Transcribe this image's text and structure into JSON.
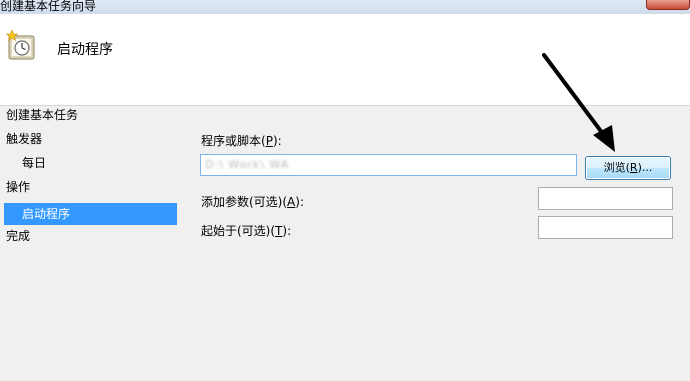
{
  "window": {
    "title": "创建基本任务向导"
  },
  "header": {
    "heading": "启动程序",
    "icon": "task-scheduler-clock-icon"
  },
  "nav": {
    "items": [
      {
        "label": "创建基本任务"
      },
      {
        "label": "触发器"
      },
      {
        "label": "每日"
      },
      {
        "label": "操作"
      },
      {
        "label": "启动程序"
      },
      {
        "label": "完成"
      }
    ],
    "selected_color": "#3399ff"
  },
  "form": {
    "program_label_prefix": "程序或脚本(",
    "program_label_key": "P",
    "program_label_suffix": "):",
    "program_value": "D:\\  Work\\  WA  ",
    "browse_prefix": "浏览(",
    "browse_key": "R",
    "browse_suffix": ")...",
    "args_label_prefix": "添加参数(可选)(",
    "args_label_key": "A",
    "args_label_suffix": "):",
    "args_value": "",
    "startin_label_prefix": "起始于(可选)(",
    "startin_label_key": "T",
    "startin_label_suffix": "):",
    "startin_value": ""
  },
  "annotation": {
    "arrow_color": "#000000"
  }
}
